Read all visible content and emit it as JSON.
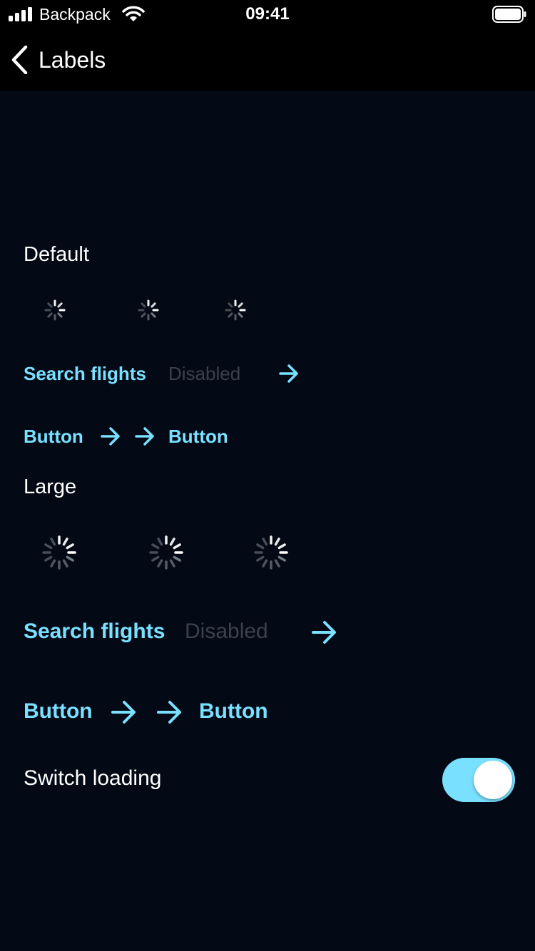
{
  "status_bar": {
    "carrier": "Backpack",
    "time": "09:41",
    "icons": [
      "signal-icon",
      "wifi-icon",
      "battery-icon"
    ]
  },
  "nav": {
    "back_icon": "chevron-left-icon",
    "title": "Labels"
  },
  "sections": {
    "default": {
      "title": "Default",
      "search_label": "Search flights",
      "disabled_label": "Disabled",
      "button_left_label": "Button",
      "button_right_label": "Button"
    },
    "large": {
      "title": "Large",
      "search_label": "Search flights",
      "disabled_label": "Disabled",
      "button_left_label": "Button",
      "button_right_label": "Button"
    }
  },
  "switch": {
    "label": "Switch loading",
    "on": true
  },
  "colors": {
    "background": "#030a15",
    "accent": "#7ae0ff",
    "disabled_text": "#3a414d"
  }
}
